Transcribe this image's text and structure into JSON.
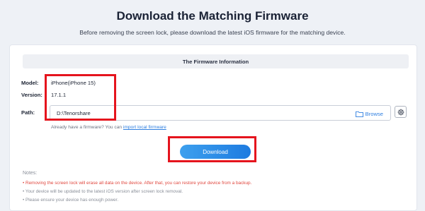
{
  "header": {
    "title": "Download the Matching Firmware",
    "subtitle": "Before removing the screen lock, please download the latest iOS firmware for the matching device."
  },
  "firmware": {
    "section_title": "The Firmware Information",
    "model_label": "Model:",
    "model_value": "iPhone(iPhone 15)",
    "version_label": "Version:",
    "version_value": "17.1.1",
    "path_label": "Path:",
    "path_value": "D:\\Tenorshare",
    "browse_label": "Browse",
    "hint_text": "Already have a firmware? You can",
    "hint_link": "import local firmware"
  },
  "actions": {
    "download_label": "Download"
  },
  "notes": {
    "title": "Notes:",
    "items": [
      "• Removing the screen lock will erase all data on the device. After that, you can restore your device from a backup.",
      "• Your device will be updated to the latest iOS version after screen lock removal.",
      "• Please ensure your device has enough power."
    ]
  },
  "colors": {
    "accent": "#2f7fe0",
    "highlight_box": "#e5141d",
    "warning": "#e0473e"
  }
}
